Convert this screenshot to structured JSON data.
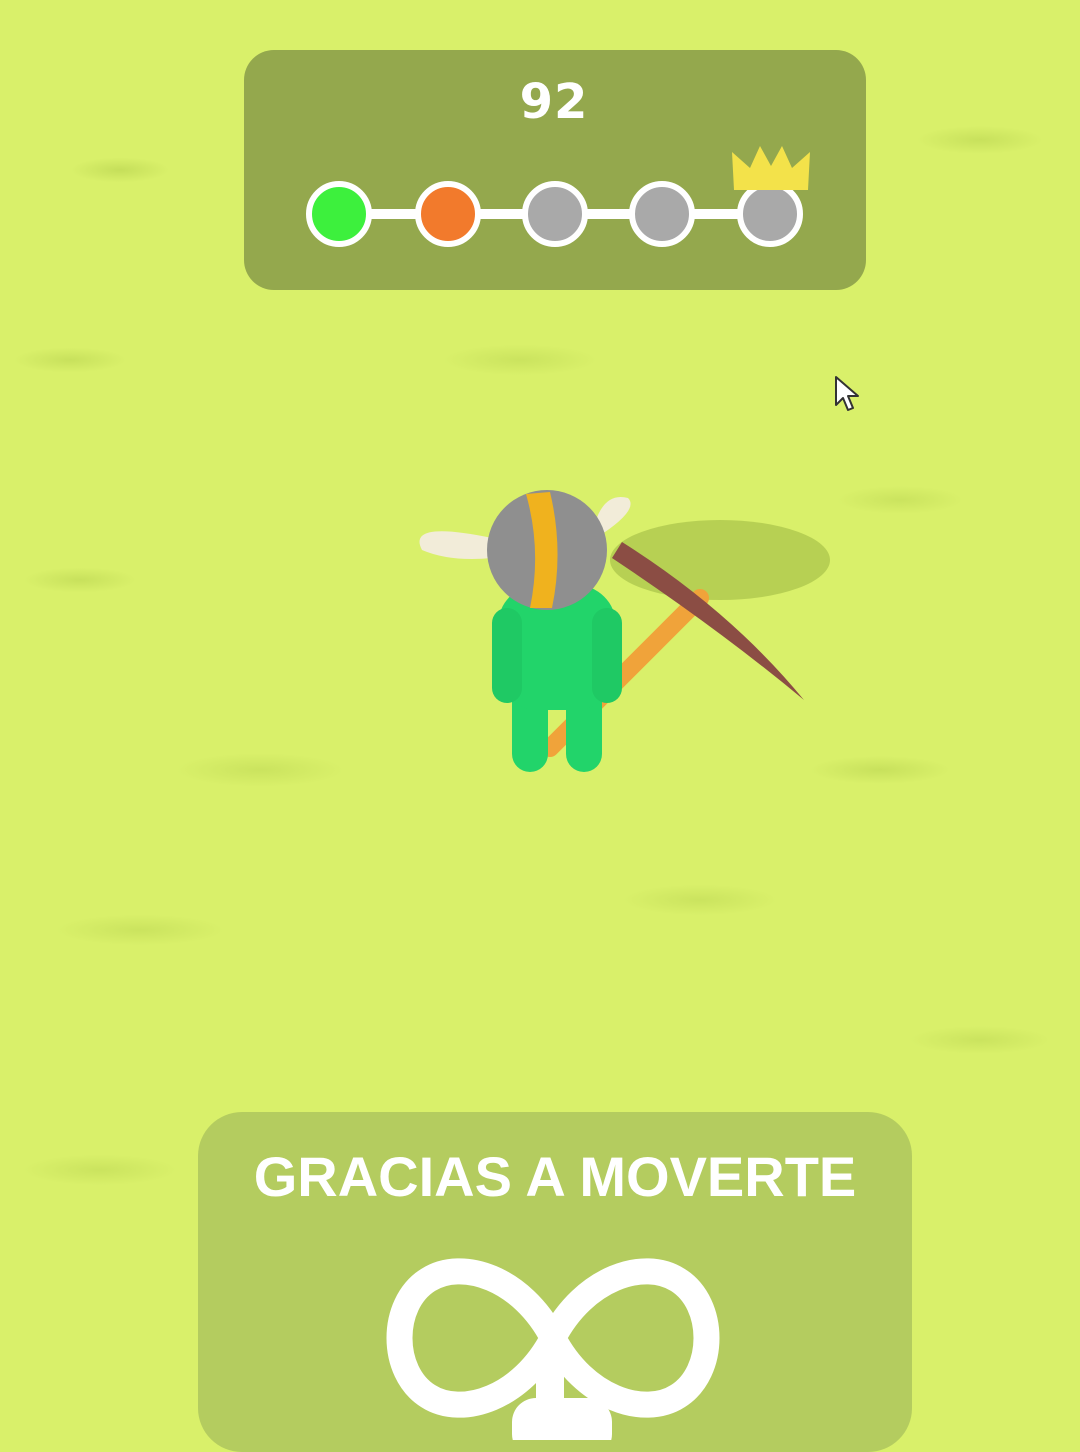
{
  "hud": {
    "score": "92",
    "stages": [
      {
        "state": "completed",
        "color": "#3df03d"
      },
      {
        "state": "current",
        "color": "#f27a2c"
      },
      {
        "state": "locked",
        "color": "#a9a9a9"
      },
      {
        "state": "locked",
        "color": "#a9a9a9"
      },
      {
        "state": "final",
        "color": "#a9a9a9"
      }
    ],
    "crown_color": "#f3e24a"
  },
  "tutorial": {
    "hint": "GRACIAS A MOVERTE",
    "gesture": "infinity-swipe-icon"
  },
  "colors": {
    "ground": "#d9f06a",
    "player_body": "#22d46a",
    "helmet": "#8f8f8f",
    "helmet_stripe": "#f0b21e",
    "horns": "#f2ecd9",
    "pickaxe_handle": "#f0a33a",
    "pickaxe_head": "#8b4d44"
  }
}
